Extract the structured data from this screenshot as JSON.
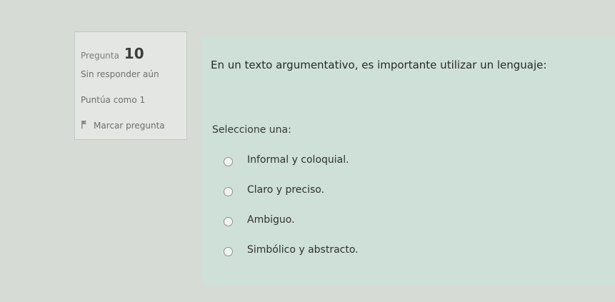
{
  "question_info": {
    "label": "Pregunta",
    "number": "10",
    "state": "Sin responder aún",
    "grade": "Puntúa como 1",
    "flag_label": "Marcar pregunta",
    "flag_icon": "flag-icon"
  },
  "question": {
    "text": "En un texto argumentativo, es importante utilizar un lenguaje:",
    "prompt": "Seleccione una:",
    "options": [
      {
        "label": "Informal y coloquial."
      },
      {
        "label": "Claro y preciso."
      },
      {
        "label": "Ambiguo."
      },
      {
        "label": "Simbólico y abstracto."
      }
    ]
  },
  "colors": {
    "page_background": "#d6dbd6",
    "info_box_background": "#e3e6e2",
    "content_background": "#cfe0d9"
  }
}
